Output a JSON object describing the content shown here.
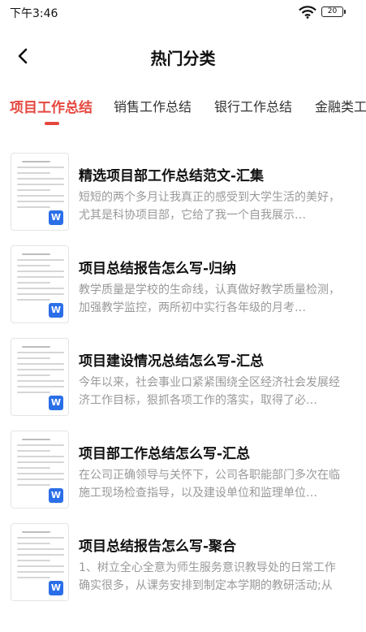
{
  "status_bar": {
    "time": "下午3:46",
    "battery": "20"
  },
  "header": {
    "title": "热门分类"
  },
  "tabs": [
    {
      "label": "项目工作总结",
      "active": true
    },
    {
      "label": "销售工作总结",
      "active": false
    },
    {
      "label": "银行工作总结",
      "active": false
    },
    {
      "label": "金融类工",
      "active": false
    }
  ],
  "items": [
    {
      "title": "精选项目部工作总结范文-汇集",
      "desc": "短短的两个多月让我真正的感受到大学生活的美好，尤其是科协项目部，它给了我一个自我展示…",
      "icon": "word-doc-icon"
    },
    {
      "title": "项目总结报告怎么写-归纳",
      "desc": "教学质量是学校的生命线，认真做好教学质量检测，加强教学监控，两所初中实行各年级的月考…",
      "icon": "word-doc-icon"
    },
    {
      "title": "项目建设情况总结怎么写-汇总",
      "desc": "今年以来，社会事业口紧紧围绕全区经济社会发展经济工作目标，狠抓各项工作的落实，取得了必…",
      "icon": "word-doc-icon"
    },
    {
      "title": "项目部工作总结怎么写-汇总",
      "desc": "在公司正确领导与关怀下，公司各职能部门多次在临施工现场检查指导，以及建设单位和监理单位…",
      "icon": "word-doc-icon"
    },
    {
      "title": "项目总结报告怎么写-聚合",
      "desc": "1、树立全心全意为师生服务意识教导处的日常工作确实很多，从课务安排到制定本学期的教研活动;从",
      "icon": "word-doc-icon"
    }
  ],
  "colors": {
    "accent": "#e5473f",
    "word_blue": "#2b6fe8"
  }
}
